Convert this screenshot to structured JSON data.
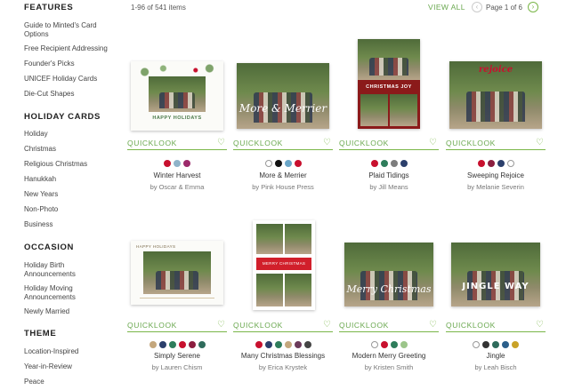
{
  "sidebar": {
    "features": {
      "heading": "FEATURES",
      "items": [
        "Guide to Minted's Card Options",
        "Free Recipient Addressing",
        "Founder's Picks",
        "UNICEF Holiday Cards",
        "Die-Cut Shapes"
      ]
    },
    "holiday_cards": {
      "heading": "HOLIDAY CARDS",
      "items": [
        "Holiday",
        "Christmas",
        "Religious Christmas",
        "Hanukkah",
        "New Years",
        "Non-Photo",
        "Business"
      ]
    },
    "occasion": {
      "heading": "OCCASION",
      "items": [
        "Holiday Birth Announcements",
        "Holiday Moving Announcements",
        "Newly Married"
      ]
    },
    "theme": {
      "heading": "THEME",
      "items": [
        "Location-Inspired",
        "Year-in-Review",
        "Peace"
      ]
    }
  },
  "topbar": {
    "items_count": "1-96 of 541 items",
    "view_all": "VIEW ALL",
    "page_info": "Page 1 of 6"
  },
  "quicklook_label": "QUICKLOOK",
  "products": [
    {
      "name": "Winter Harvest",
      "artist": "by Oscar & Emma",
      "overlay": "HAPPY HOLIDAYS",
      "swatches": [
        "#c8102e",
        "#8fb3c9",
        "#9c2a6b"
      ]
    },
    {
      "name": "More & Merrier",
      "artist": "by Pink House Press",
      "overlay": "More & Merrier",
      "swatches": [
        "#ffffff",
        "#111111",
        "#6aa6c8",
        "#c8102e"
      ]
    },
    {
      "name": "Plaid Tidings",
      "artist": "by Jill Means",
      "overlay": "CHRISTMAS JOY",
      "swatches": [
        "#c8102e",
        "#2e7d5b",
        "#7d7d7d",
        "#2b3f6b"
      ]
    },
    {
      "name": "Sweeping Rejoice",
      "artist": "by Melanie Severin",
      "overlay": "rejoice",
      "swatches": [
        "#c8102e",
        "#8b1e3f",
        "#2b3f6b",
        "#ffffff"
      ]
    },
    {
      "name": "Simply Serene",
      "artist": "by Lauren Chism",
      "overlay": "HAPPY HOLIDAYS",
      "swatches": [
        "#c4a77d",
        "#2b3f6b",
        "#2e7d5b",
        "#c8102e",
        "#8b1e3f",
        "#2e6b5b"
      ]
    },
    {
      "name": "Many Christmas Blessings",
      "artist": "by Erica Krystek",
      "overlay": "MERRY CHRISTMAS",
      "swatches": [
        "#c8102e",
        "#2b3f6b",
        "#2e7d5b",
        "#c4a77d",
        "#6b3a5a",
        "#444444"
      ]
    },
    {
      "name": "Modern Merry Greeting",
      "artist": "by Kristen Smith",
      "overlay": "Merry Christmas",
      "swatches": [
        "#ffffff",
        "#c8102e",
        "#2e7d5b",
        "#9cc58a"
      ]
    },
    {
      "name": "Jingle",
      "artist": "by Leah Bisch",
      "overlay": "JINGLE WAY",
      "swatches": [
        "#ffffff",
        "#333333",
        "#2e6b5b",
        "#2b5f8a",
        "#c9a227"
      ]
    }
  ]
}
